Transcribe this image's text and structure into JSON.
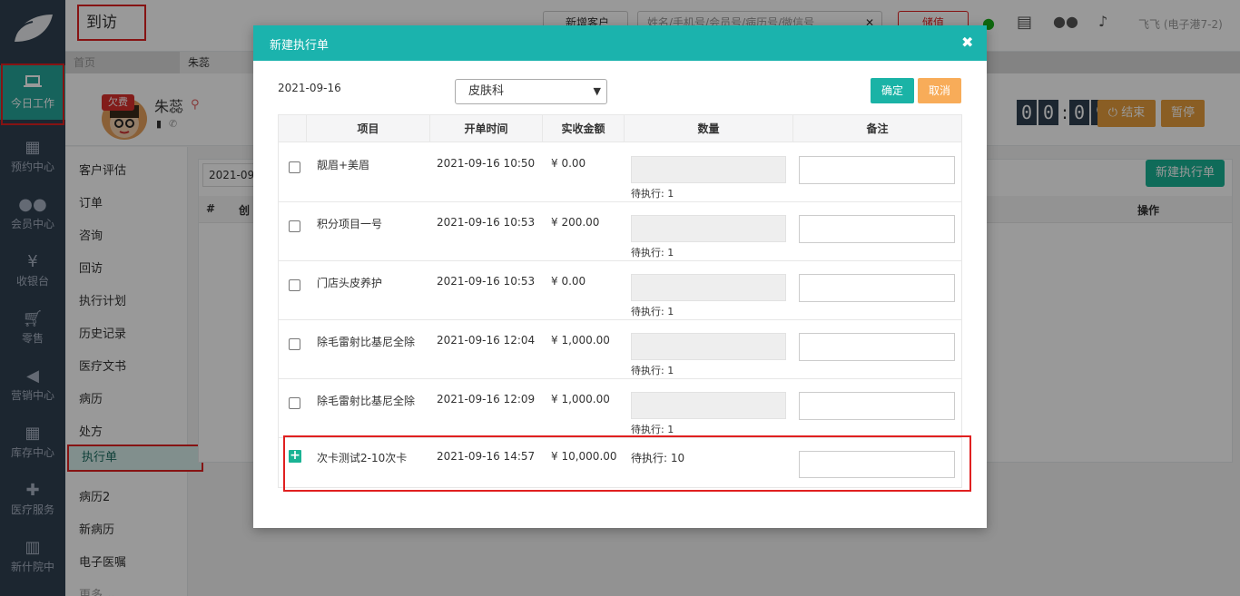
{
  "topbar": {
    "page_title": "到访",
    "new_customer": "新增客户",
    "search_placeholder": "姓名/手机号/会员号/病历号/微信号",
    "recharge": "储值",
    "user": "飞飞 (电子港7-2)"
  },
  "tabs": [
    {
      "label": "首页"
    },
    {
      "label": "朱蕊"
    }
  ],
  "sidebar": {
    "items": [
      {
        "label": "今日工作",
        "icon": "laptop-icon"
      },
      {
        "label": "预约中心",
        "icon": "calendar-icon"
      },
      {
        "label": "会员中心",
        "icon": "users-icon"
      },
      {
        "label": "收银台",
        "icon": "yen-icon"
      },
      {
        "label": "零售",
        "icon": "cart-icon"
      },
      {
        "label": "营销中心",
        "icon": "megaphone-icon"
      },
      {
        "label": "库存中心",
        "icon": "grid-icon"
      },
      {
        "label": "医疗服务",
        "icon": "medkit-icon"
      },
      {
        "label": "新什院中",
        "icon": "hospital-icon"
      }
    ]
  },
  "customer": {
    "badge": "欠费",
    "name": "朱蕊",
    "timer": [
      "0",
      "0",
      "0",
      "9"
    ],
    "end_label": "结束",
    "pause_label": "暂停"
  },
  "submenu": [
    "客户评估",
    "订单",
    "咨询",
    "回访",
    "执行计划",
    "历史记录",
    "医疗文书",
    "病历",
    "处方",
    "执行单",
    "病历2",
    "新病历",
    "电子医嘱",
    "更多"
  ],
  "main": {
    "date_filter": "2021-09",
    "col_hash": "#",
    "col_created": "创",
    "col_action": "操作",
    "new_button": "新建执行单"
  },
  "modal": {
    "title": "新建执行单",
    "date": "2021-09-16",
    "department": "皮肤科",
    "confirm": "确定",
    "cancel": "取消",
    "headers": [
      "项目",
      "开单时间",
      "实收金额",
      "数量",
      "备注"
    ],
    "rows": [
      {
        "name": "靓眉+美眉",
        "time": "2021-09-16 10:50",
        "amount": "¥ 0.00",
        "pending": "待执行: 1"
      },
      {
        "name": "积分项目一号",
        "time": "2021-09-16 10:53",
        "amount": "¥ 200.00",
        "pending": "待执行: 1"
      },
      {
        "name": "门店头皮养护",
        "time": "2021-09-16 10:53",
        "amount": "¥ 0.00",
        "pending": "待执行: 1"
      },
      {
        "name": "除毛雷射比基尼全除",
        "time": "2021-09-16 12:04",
        "amount": "¥ 1,000.00",
        "pending": "待执行: 1"
      },
      {
        "name": "除毛雷射比基尼全除",
        "time": "2021-09-16 12:09",
        "amount": "¥ 1,000.00",
        "pending": "待执行: 1"
      }
    ],
    "card_row": {
      "name": "次卡测试2-10次卡",
      "time": "2021-09-16 14:57",
      "amount": "¥ 10,000.00",
      "pending": "待执行: 10"
    }
  }
}
